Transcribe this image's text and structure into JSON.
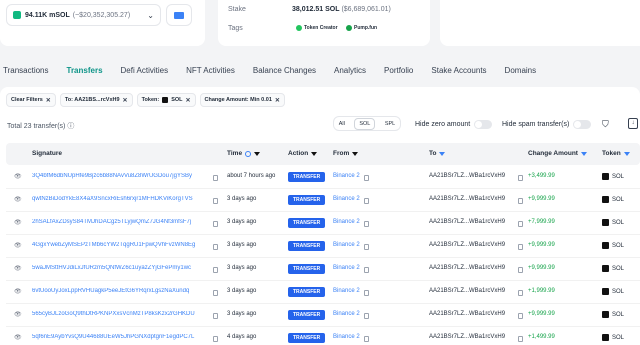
{
  "balance": {
    "amount": "94.11K mSOL",
    "usd": "(~$20,352,305.27)"
  },
  "stake": {
    "label": "Stake",
    "value": "38,012.51 SOL",
    "usd": "($6,689,061.01)"
  },
  "tags": {
    "label": "Tags",
    "items": [
      "Token Creator",
      "Pump.fun"
    ]
  },
  "tabs": [
    "Transactions",
    "Transfers",
    "Defi Activities",
    "NFT Activities",
    "Balance Changes",
    "Analytics",
    "Portfolio",
    "Stake Accounts",
    "Domains"
  ],
  "active_tab": "Transfers",
  "filters": {
    "clear": "Clear Filters",
    "to": "To: AA21BS...rcVxH9",
    "token_label": "Token:",
    "token_value": "SOL",
    "change": "Change Amount:  Min 0.01"
  },
  "total": "Total 23 transfer(s)",
  "segment": [
    "All",
    "SOL",
    "SPL"
  ],
  "segment_selected": "SOL",
  "hide_zero": "Hide zero amount",
  "hide_spam": "Hide spam transfer(s)",
  "columns": {
    "signature": "Signature",
    "time": "Time",
    "action": "Action",
    "from": "From",
    "to": "To",
    "change": "Change Amount",
    "token": "Token"
  },
  "rows": [
    {
      "sig": "3Q4bfM6dbNUpHfe9Bjzc6b88NAvVu8Z8WrUGDou7jgYSBy",
      "time": "about 7 hours ago",
      "action": "TRANSFER",
      "from": "Binance 2",
      "to": "AA21BSr7LZ...WBa1rcVxH9",
      "change": "+3,499.99",
      "token": "SOL"
    },
    {
      "sig": "qwtNzBiDodYkE8X4aX9SncxRiEsh6rxjr1MFHDKViKorgTVS",
      "time": "3 days ago",
      "action": "TRANSFER",
      "from": "Binance 2",
      "to": "AA21BSr7LZ...WBa1rcVxH9",
      "change": "+9,999.99",
      "token": "SOL"
    },
    {
      "sig": "2hSALfAxZDsyS84TMJhDACgz5TLyjwQmZ7JG4Nf3mfsF7j",
      "time": "3 days ago",
      "action": "TRANSFER",
      "from": "Binance 2",
      "to": "AA21BSr7LZ...WBa1rcVxH9",
      "change": "+7,999.99",
      "token": "SOL"
    },
    {
      "sig": "4GgxYwebZyMSEPzTMb6cYW2TqgRU1FpwQVhFvzWN8Eg",
      "time": "3 days ago",
      "action": "TRANSFER",
      "from": "Binance 2",
      "to": "AA21BSr7LZ...WBa1rcVxH9",
      "change": "+9,999.99",
      "token": "SOL"
    },
    {
      "sig": "5waJMSttHVJdiLxJfURzm5QNfWZ6c1uyazZYjGFePmy1wc",
      "time": "3 days ago",
      "action": "TRANSFER",
      "from": "Binance 2",
      "to": "AA21BSr7LZ...WBa1rcVxH9",
      "change": "+9,999.99",
      "token": "SOL"
    },
    {
      "sig": "6vtUooUyJoxLppRVHUagkP5eeJEtG6YRqrxLgszNaXundq",
      "time": "3 days ago",
      "action": "TRANSFER",
      "from": "Binance 2",
      "to": "AA21BSr7LZ...WBa1rcVxH9",
      "change": "+1,999.99",
      "token": "SOL"
    },
    {
      "sig": "565cyBJLzoGoQ9thDtRPKNPXxsVcnMzTP8ksKzx2rGHKDU",
      "time": "3 days ago",
      "action": "TRANSFER",
      "from": "Binance 2",
      "to": "AA21BSr7LZ...WBa1rcVxH9",
      "change": "+9,999.99",
      "token": "SOL"
    },
    {
      "sig": "5qf6nE9AybYvsQ9U44688UEeW5JhPGNXdptgnF1egdPC7L",
      "time": "4 days ago",
      "action": "TRANSFER",
      "from": "Binance 2",
      "to": "AA21BSr7LZ...WBa1rcVxH9",
      "change": "+1,499.99",
      "token": "SOL"
    }
  ]
}
